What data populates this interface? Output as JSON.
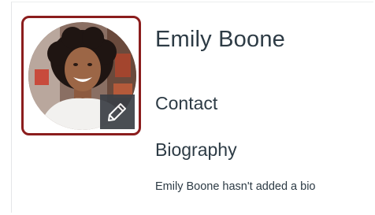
{
  "profile": {
    "name": "Emily Boone",
    "avatar_icon": "user-photo",
    "edit_icon": "pencil-icon",
    "sections": {
      "contact": "Contact",
      "biography": "Biography"
    },
    "bio_text": "Emily Boone hasn't added a bio"
  },
  "colors": {
    "avatar_border": "#8b1d1d",
    "text": "#2d3b45",
    "edit_badge": "#3b3f45"
  }
}
